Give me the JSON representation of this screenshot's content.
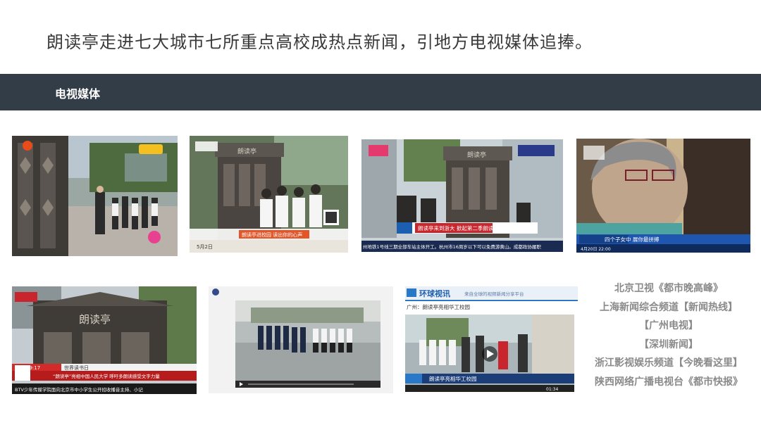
{
  "title": "朗读亭走进七大城市七所重点高校成热点新闻，引地方电视媒体追捧。",
  "band_label": "电视媒体",
  "media_list": [
    "北京卫视《都市晚高峰》",
    "上海新闻综合频道【新闻热线】",
    "【广州电视】",
    "【深圳新闻】",
    "浙江影视娱乐频道【今晚看这里】",
    "陕西网络广播电视台《都市快报》"
  ],
  "screenshots": [
    {
      "kiosk": "朗读亭",
      "ticker": "朗读亭进校园 读出你的心声",
      "date": "5月2日"
    },
    {
      "kiosk": "朗读亭",
      "headline": "朗读亭来到浙大 掀起第二季朗读潮",
      "ticker": "州地铁1号线三期全部车站主体开工。杭州市16周岁以下可以免费游黄山。成都政协履职"
    },
    {
      "headline": "四个子女中 展你最拼搏",
      "time": "4月20日 22:00"
    },
    {
      "kiosk": "朗读亭",
      "sub": "世界读书日",
      "headline": "“朗读亭”亮相中国人民大学 呼吁多朗读感受文字力量",
      "ticker": "BTV少年传媒学院面向北京市中小学生公开招收播音主持、小记",
      "clock": "19:17"
    },
    {},
    {
      "brand": "环球视讯",
      "slogan": "来自全球的视频新闻分享平台",
      "location": "广州：朗读亭亮相华工校园",
      "headline": "朗读亭亮相华工校园",
      "time": "01:34"
    }
  ],
  "colors": {
    "band": "#333d48",
    "title": "#3a3a3a",
    "caption": "#8a8a8a",
    "ticker_blue": "#1c5fb0",
    "ticker_red": "#c8252c"
  }
}
